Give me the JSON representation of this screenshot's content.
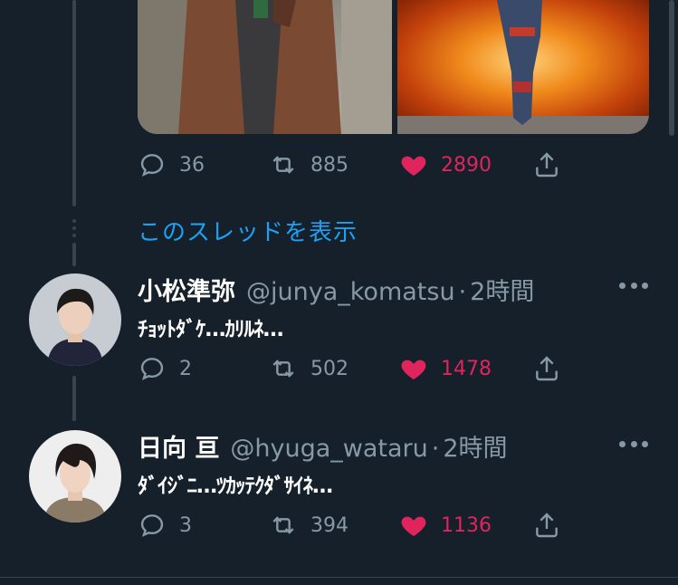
{
  "top_tweet": {
    "actions": {
      "reply_count": "36",
      "retweet_count": "885",
      "like_count": "2890"
    }
  },
  "show_thread_label": "このスレッドを表示",
  "tweets": [
    {
      "display_name": "小松準弥",
      "handle": "@junya_komatsu",
      "separator": "·",
      "time": "2時間",
      "text": "ﾁｮｯﾄﾀﾞｹ…ｶﾘﾙﾈ…",
      "reply_count": "2",
      "retweet_count": "502",
      "like_count": "1478"
    },
    {
      "display_name": "日向 亘",
      "handle": "@hyuga_wataru",
      "separator": "·",
      "time": "2時間",
      "text": "ﾀﾞｲｼﾞﾆ…ﾂｶｯﾃｸﾀﾞｻｲﾈ…",
      "reply_count": "3",
      "retweet_count": "394",
      "like_count": "1136"
    }
  ],
  "colors": {
    "background": "#15202b",
    "secondary_text": "#8899a6",
    "link": "#1da1f2",
    "like": "#e0245e",
    "border": "#38444d"
  },
  "icons": {
    "reply": "reply-icon",
    "retweet": "retweet-icon",
    "like": "heart-icon",
    "share": "share-icon",
    "more": "more-icon"
  }
}
